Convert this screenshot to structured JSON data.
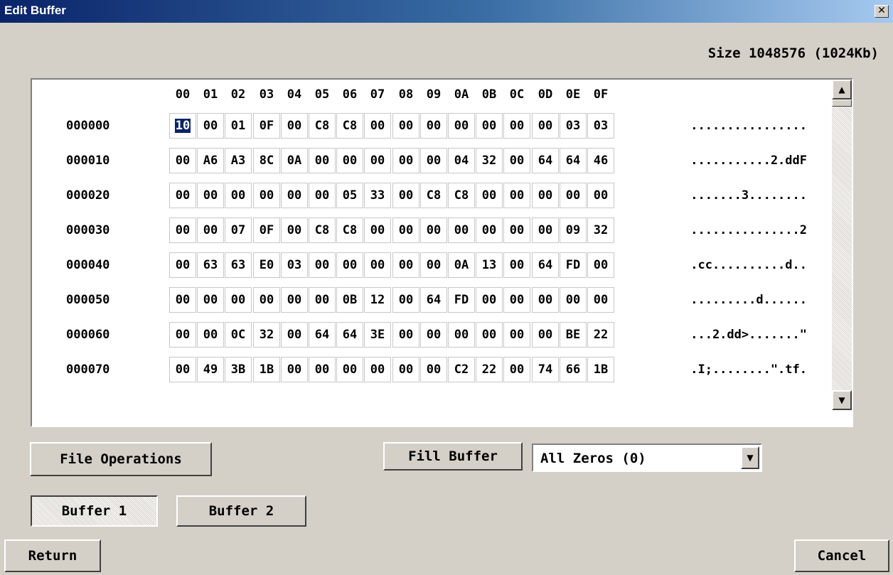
{
  "window": {
    "title": "Edit Buffer",
    "close_symbol": "✕"
  },
  "size_label": "Size 1048576 (1024Kb)",
  "hex_editor": {
    "columns": [
      "00",
      "01",
      "02",
      "03",
      "04",
      "05",
      "06",
      "07",
      "08",
      "09",
      "0A",
      "0B",
      "0C",
      "0D",
      "0E",
      "0F"
    ],
    "selected_cell": {
      "row": 0,
      "col": 0
    },
    "rows": [
      {
        "addr": "000000",
        "bytes": [
          "10",
          "00",
          "01",
          "0F",
          "00",
          "C8",
          "C8",
          "00",
          "00",
          "00",
          "00",
          "00",
          "00",
          "00",
          "03",
          "03"
        ],
        "ascii": "................"
      },
      {
        "addr": "000010",
        "bytes": [
          "00",
          "A6",
          "A3",
          "8C",
          "0A",
          "00",
          "00",
          "00",
          "00",
          "00",
          "04",
          "32",
          "00",
          "64",
          "64",
          "46"
        ],
        "ascii": "...........2.ddF"
      },
      {
        "addr": "000020",
        "bytes": [
          "00",
          "00",
          "00",
          "00",
          "00",
          "00",
          "05",
          "33",
          "00",
          "C8",
          "C8",
          "00",
          "00",
          "00",
          "00",
          "00"
        ],
        "ascii": ".......3........"
      },
      {
        "addr": "000030",
        "bytes": [
          "00",
          "00",
          "07",
          "0F",
          "00",
          "C8",
          "C8",
          "00",
          "00",
          "00",
          "00",
          "00",
          "00",
          "00",
          "09",
          "32"
        ],
        "ascii": "...............2"
      },
      {
        "addr": "000040",
        "bytes": [
          "00",
          "63",
          "63",
          "E0",
          "03",
          "00",
          "00",
          "00",
          "00",
          "00",
          "0A",
          "13",
          "00",
          "64",
          "FD",
          "00"
        ],
        "ascii": ".cc..........d.."
      },
      {
        "addr": "000050",
        "bytes": [
          "00",
          "00",
          "00",
          "00",
          "00",
          "00",
          "0B",
          "12",
          "00",
          "64",
          "FD",
          "00",
          "00",
          "00",
          "00",
          "00"
        ],
        "ascii": ".........d......"
      },
      {
        "addr": "000060",
        "bytes": [
          "00",
          "00",
          "0C",
          "32",
          "00",
          "64",
          "64",
          "3E",
          "00",
          "00",
          "00",
          "00",
          "00",
          "00",
          "BE",
          "22"
        ],
        "ascii": "...2.dd>.......\""
      },
      {
        "addr": "000070",
        "bytes": [
          "00",
          "49",
          "3B",
          "1B",
          "00",
          "00",
          "00",
          "00",
          "00",
          "00",
          "C2",
          "22",
          "00",
          "74",
          "66",
          "1B"
        ],
        "ascii": ".I;........\".tf."
      }
    ]
  },
  "scrollbar": {
    "up_icon": "up-arrow-icon",
    "down_icon": "down-arrow-icon"
  },
  "buttons": {
    "file_operations": "File Operations",
    "fill_buffer": "Fill Buffer",
    "buffer1": "Buffer 1",
    "buffer2": "Buffer 2",
    "return": "Return",
    "cancel": "Cancel"
  },
  "fill_select": {
    "value": "All Zeros (0)"
  },
  "colors": {
    "titlebar_start": "#0a246a",
    "titlebar_end": "#a6caf0",
    "selection": "#0a246a",
    "window_bg": "#d4d0c8"
  }
}
